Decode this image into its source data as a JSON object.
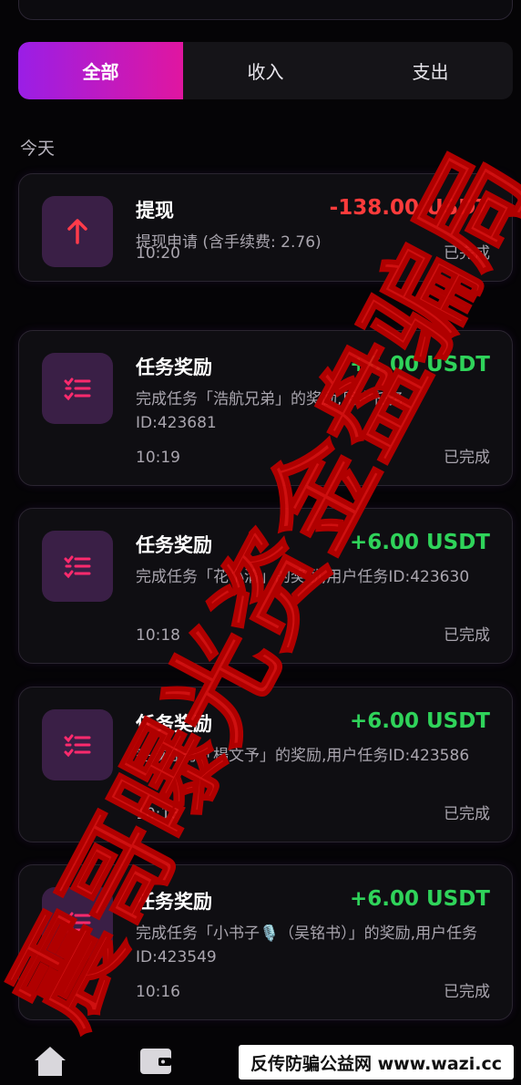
{
  "tabs": [
    {
      "label": "全部",
      "active": true
    },
    {
      "label": "收入",
      "active": false
    },
    {
      "label": "支出",
      "active": false
    }
  ],
  "section_label": "今天",
  "transactions": [
    {
      "icon": "arrow-up-icon",
      "title": "提现",
      "amount": "-138.00 USDT",
      "type": "negative",
      "desc": "提现申请 (含手续费: 2.76)",
      "time": "10:20",
      "status": "已完成"
    },
    {
      "icon": "task-list-icon",
      "title": "任务奖励",
      "amount": "+6.00 USDT",
      "type": "positive",
      "desc": "完成任务「浩航兄弟」的奖励,用户任务ID:423681",
      "time": "10:19",
      "status": "已完成"
    },
    {
      "icon": "task-list-icon",
      "title": "任务奖励",
      "amount": "+6.00 USDT",
      "type": "positive",
      "desc": "完成任务「花小清」的奖励,用户任务ID:423630",
      "time": "10:18",
      "status": "已完成"
    },
    {
      "icon": "task-list-icon",
      "title": "任务奖励",
      "amount": "+6.00 USDT",
      "type": "positive",
      "desc": "完成任务「楊文予」的奖励,用户任务ID:423586",
      "time": "10:18",
      "status": "已完成"
    },
    {
      "icon": "task-list-icon",
      "title": "任务奖励",
      "amount": "+6.00 USDT",
      "type": "positive",
      "desc": "完成任务「小书子🎙️（吴铭书）」的奖励,用户任务ID:423549",
      "time": "10:16",
      "status": "已完成"
    }
  ],
  "bottom_nav": [
    "home-icon",
    "wallet-icon",
    "team-icon",
    "profile-icon"
  ],
  "stamp_text": "震哥曝光资金盘骗局",
  "watermark_text": "反传防骗公益网 www.wazi.cc",
  "colors": {
    "accent_start": "#9a1ee6",
    "accent_end": "#e016a0",
    "negative": "#ff3b3b",
    "positive": "#2fd35a",
    "stamp": "#e01010"
  }
}
